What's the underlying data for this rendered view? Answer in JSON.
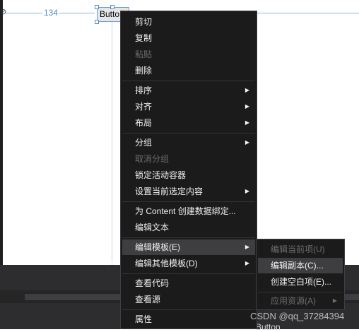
{
  "canvas": {
    "guide_number": "134",
    "button_text": "Butto"
  },
  "context_menu": {
    "items": [
      {
        "label": "剪切",
        "enabled": true
      },
      {
        "label": "复制",
        "enabled": true
      },
      {
        "label": "粘贴",
        "enabled": false
      },
      {
        "label": "删除",
        "enabled": true
      },
      {
        "label": "排序",
        "enabled": true,
        "submenu": true
      },
      {
        "label": "对齐",
        "enabled": true,
        "submenu": true
      },
      {
        "label": "布局",
        "enabled": true,
        "submenu": true
      },
      {
        "label": "分组",
        "enabled": true,
        "submenu": true
      },
      {
        "label": "取消分组",
        "enabled": false
      },
      {
        "label": "锁定活动容器",
        "enabled": true
      },
      {
        "label": "设置当前选定内容",
        "enabled": true,
        "submenu": true
      },
      {
        "label": "为 Content 创建数据绑定...",
        "enabled": true
      },
      {
        "label": "编辑文本",
        "enabled": true
      },
      {
        "label": "编辑模板(E)",
        "enabled": true,
        "submenu": true,
        "highlighted": true
      },
      {
        "label": "编辑其他模板(D)",
        "enabled": true,
        "submenu": true
      },
      {
        "label": "查看代码",
        "enabled": true
      },
      {
        "label": "查看源",
        "enabled": true
      },
      {
        "label": "属性",
        "enabled": true
      }
    ]
  },
  "template_submenu": {
    "items": [
      {
        "label": "编辑当前项(U)",
        "enabled": false
      },
      {
        "label": "编辑副本(C)...",
        "enabled": true,
        "highlighted": true
      },
      {
        "label": "创建空白项(E)...",
        "enabled": true
      },
      {
        "label": "应用资源(A)",
        "enabled": false,
        "submenu": true
      }
    ]
  },
  "bottom": {
    "partial_label": "Button",
    "watermark": "CSDN @qq_37284394"
  },
  "colors": {
    "menu_bg": "#1b1b1c",
    "menu_text": "#f1f1f1",
    "disabled_text": "#6d6d6d",
    "highlight": "#3e3e40",
    "guide_blue": "#4f8fd0"
  }
}
